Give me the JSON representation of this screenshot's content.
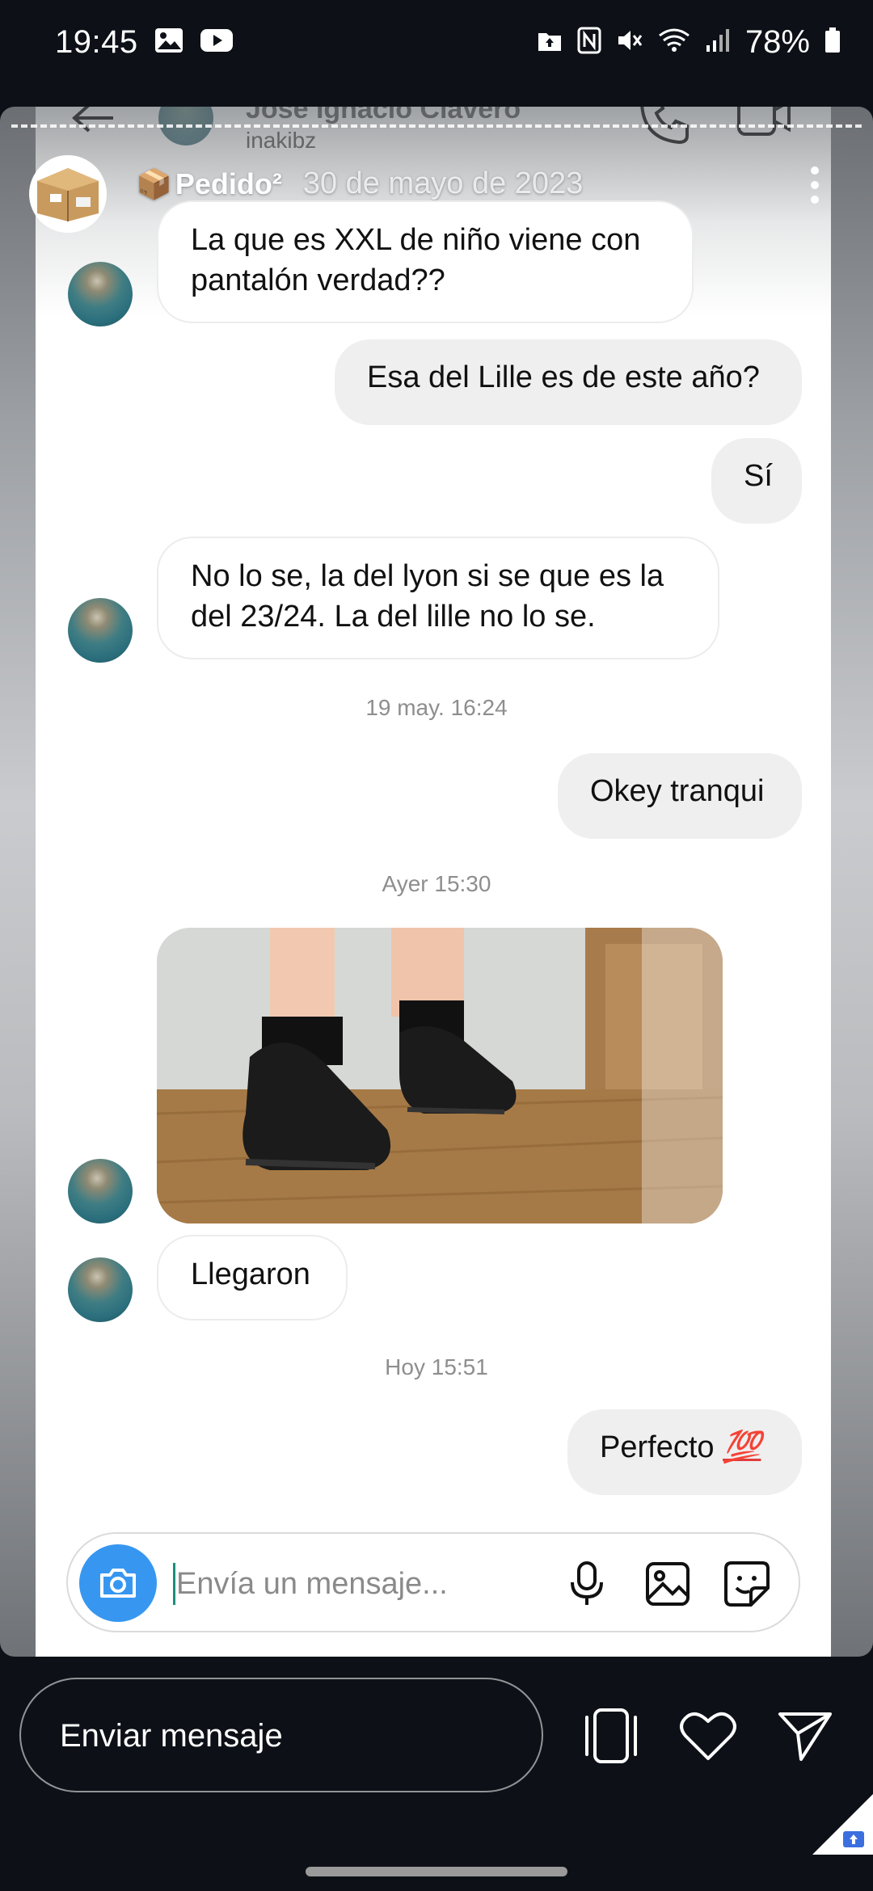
{
  "status_bar": {
    "time": "19:45",
    "battery": "78%",
    "left_icons": [
      "gallery-icon",
      "youtube-icon"
    ],
    "right_icons": [
      "upload-icon",
      "nfc-icon",
      "mute-icon",
      "wifi-icon",
      "signal-icon",
      "battery-icon"
    ]
  },
  "chat_header": {
    "name": "José Ignacio Clavero",
    "username": "inakibz",
    "icons": [
      "back-arrow-icon",
      "phone-icon",
      "video-call-icon"
    ]
  },
  "story": {
    "name": "Pedido²",
    "emoji": "📦",
    "date": "30 de mayo de 2023",
    "more_icon": "more-vertical-icon"
  },
  "messages": [
    {
      "dir": "in",
      "text": "La que es XXL de niño viene con pantalón verdad??"
    },
    {
      "dir": "out",
      "text": "Esa del Lille es de este año?"
    },
    {
      "dir": "out",
      "text": "Sí"
    },
    {
      "dir": "in",
      "text": "No lo se, la del lyon si se que es la del 23/24. La del lille no lo se."
    },
    {
      "type": "timestamp",
      "text": "19 may. 16:24"
    },
    {
      "dir": "out",
      "text": "Okey tranqui"
    },
    {
      "type": "timestamp",
      "text": "Ayer 15:30"
    },
    {
      "dir": "in",
      "type": "photo"
    },
    {
      "dir": "in",
      "text": "Llegaron"
    },
    {
      "type": "timestamp",
      "text": "Hoy 15:51"
    },
    {
      "dir": "out",
      "text": "Perfecto",
      "emoji": "💯"
    }
  ],
  "composer": {
    "placeholder": "Envía un mensaje...",
    "icons": [
      "camera-icon",
      "microphone-icon",
      "gallery-icon",
      "sticker-icon"
    ]
  },
  "story_reply": {
    "placeholder": "Enviar mensaje",
    "icons": [
      "screens-icon",
      "heart-icon",
      "send-icon"
    ]
  },
  "colors": {
    "accent": "#3797f0",
    "out_bubble": "#efefef",
    "in_bubble_border": "#ececec",
    "story_background": "#0d1117",
    "hundred_emoji": "#e23b3b"
  }
}
